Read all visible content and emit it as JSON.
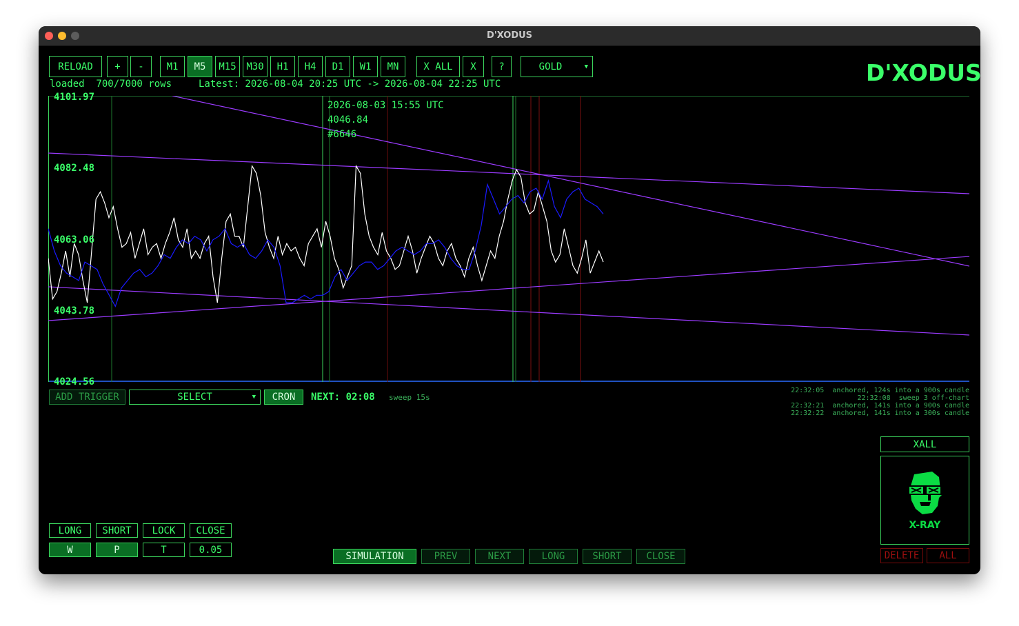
{
  "window": {
    "title": "D'XODUS",
    "traffic_lights": [
      "#fe5f57",
      "#febc2e",
      "#5c5c5c"
    ]
  },
  "toolbar": {
    "reload": "RELOAD",
    "zoom_in": "+",
    "zoom_out": "-",
    "timeframes": [
      "M1",
      "M5",
      "M15",
      "M30",
      "H1",
      "H4",
      "D1",
      "W1",
      "MN"
    ],
    "active_timeframe": "M5",
    "x_all": "X ALL",
    "x": "X",
    "help": "?",
    "symbol": "GOLD",
    "symbol_arrow": "▼"
  },
  "brand": "D'XODUS",
  "status": {
    "loaded": "loaded  700/7000 rows",
    "latest": "Latest: 2026-08-04 20:25 UTC -> 2026-08-04 22:25 UTC"
  },
  "chart_data": {
    "type": "line",
    "ylim": [
      4024.56,
      4101.97
    ],
    "yticks": [
      "4101.97",
      "4082.48",
      "4063.06",
      "4043.78",
      "4024.56"
    ],
    "xlim": [
      0,
      1000
    ],
    "series": [
      {
        "color": "#ffffff",
        "values": [
          4058,
          4047,
          4049,
          4054,
          4060,
          4053,
          4062,
          4059,
          4052,
          4046,
          4060,
          4074,
          4076,
          4073,
          4069,
          4072,
          4066,
          4061,
          4062,
          4065,
          4058,
          4062,
          4066,
          4059,
          4061,
          4062,
          4058,
          4062,
          4065,
          4069,
          4063,
          4061,
          4066,
          4058,
          4060,
          4058,
          4062,
          4064,
          4053,
          4046,
          4058,
          4068,
          4070,
          4064,
          4064,
          4061,
          4072,
          4083,
          4081,
          4075,
          4065,
          4061,
          4058,
          4064,
          4059,
          4062,
          4060,
          4061,
          4058,
          4056,
          4062,
          4064,
          4066,
          4061,
          4068,
          4064,
          4058,
          4055,
          4050,
          4053,
          4056,
          4083,
          4081,
          4070,
          4064,
          4061,
          4059,
          4065,
          4060,
          4058,
          4055,
          4056,
          4060,
          4064,
          4060,
          4054,
          4058,
          4061,
          4064,
          4062,
          4058,
          4056,
          4060,
          4062,
          4058,
          4056,
          4053,
          4058,
          4061,
          4056,
          4052,
          4056,
          4060,
          4058,
          4064,
          4068,
          4074,
          4079,
          4082,
          4080,
          4073,
          4070,
          4071,
          4076,
          4072,
          4068,
          4060,
          4057,
          4059,
          4066,
          4061,
          4056,
          4054,
          4058,
          4063,
          4054,
          4057,
          4060,
          4057
        ]
      },
      {
        "color": "#1a1aff",
        "values": [
          4066,
          4060,
          4056,
          4054,
          4053,
          4052,
          4057,
          4056,
          4055,
          4051,
          4048,
          4045,
          4050,
          4052,
          4054,
          4055,
          4053,
          4054,
          4056,
          4059,
          4058,
          4061,
          4063,
          4062,
          4064,
          4063,
          4060,
          4063,
          4064,
          4066,
          4062,
          4061,
          4062,
          4059,
          4058,
          4060,
          4063,
          4061,
          4056,
          4046,
          4046,
          4047,
          4048,
          4047,
          4048,
          4048,
          4049,
          4053,
          4055,
          4052,
          4054,
          4056,
          4057,
          4057,
          4055,
          4056,
          4058,
          4060,
          4061,
          4060,
          4059,
          4060,
          4062,
          4062,
          4063,
          4061,
          4058,
          4056,
          4055,
          4055,
          4060,
          4067,
          4078,
          4074,
          4070,
          4072,
          4074,
          4075,
          4073,
          4076,
          4077,
          4074,
          4079,
          4072,
          4069,
          4074,
          4076,
          4077,
          4074,
          4073,
          4072,
          4070
        ]
      }
    ],
    "grid": false,
    "crosshair": {
      "time": "2026-08-03 15:55 UTC",
      "price": "4046.84",
      "index": "#6646"
    }
  },
  "controls": {
    "add_trigger": "ADD TRIGGER",
    "select": "SELECT",
    "select_arrow": "▼",
    "cron": "CRON",
    "next": "NEXT: 02:08",
    "sweep": "sweep 15s"
  },
  "log": [
    "22:32:05  anchored, 124s into a 900s candle",
    "22:32:08  sweep 3 off-chart",
    "22:32:21  anchored, 141s into a 900s candle",
    "22:32:22  anchored, 141s into a 300s candle"
  ],
  "trade": {
    "long": "LONG",
    "short": "SHORT",
    "lock": "LOCK",
    "close": "CLOSE",
    "w": "W",
    "p": "P",
    "t": "T",
    "lot": "0.05"
  },
  "sim": {
    "simulation": "SIMULATION",
    "prev": "PREV",
    "next": "NEXT",
    "long": "LONG",
    "short": "SHORT",
    "close": "CLOSE"
  },
  "xray": {
    "xall": "XALL",
    "label": "X-RAY",
    "delete": "DELETE",
    "all": "ALL"
  }
}
